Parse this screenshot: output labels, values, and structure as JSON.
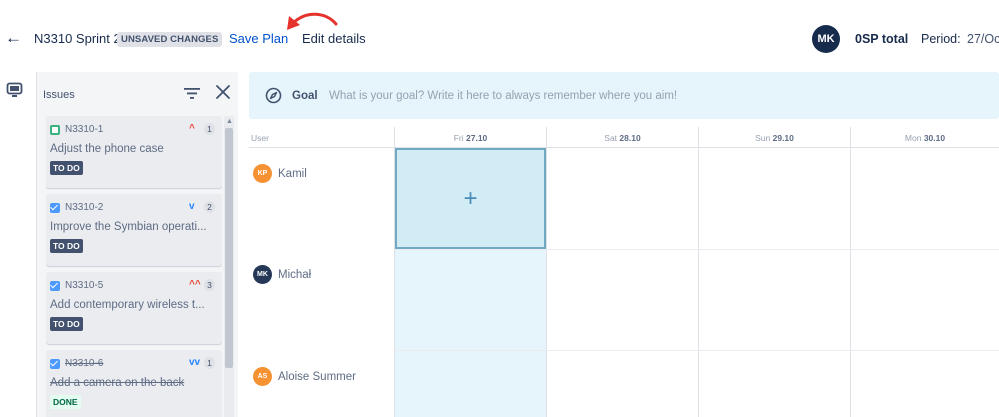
{
  "header": {
    "plan_title": "N3310 Sprint 2",
    "unsaved_badge": "UNSAVED CHANGES",
    "save_label": "Save Plan",
    "edit_label": "Edit details",
    "avatar_initials": "MK",
    "total_sp": "0SP total",
    "period_label": "Period:",
    "period_value": "27/Oc"
  },
  "issues_panel": {
    "title": "Issues",
    "issues": [
      {
        "key": "N3310-1",
        "type": "story",
        "priority": "high",
        "priority_glyph": "^",
        "estimate": "1",
        "summary": "Adjust the phone case",
        "status": "TO DO",
        "done": false
      },
      {
        "key": "N3310-2",
        "type": "task",
        "priority": "low",
        "priority_glyph": "v",
        "estimate": "2",
        "summary": "Improve the Symbian operati...",
        "status": "TO DO",
        "done": false
      },
      {
        "key": "N3310-5",
        "type": "task",
        "priority": "highest",
        "priority_glyph": "^^",
        "estimate": "3",
        "summary": "Add contemporary wireless t...",
        "status": "TO DO",
        "done": false
      },
      {
        "key": "N3310-6",
        "type": "task",
        "priority": "lowest",
        "priority_glyph": "vv",
        "estimate": "1",
        "summary": "Add a camera on the back",
        "status": "DONE",
        "done": true
      }
    ]
  },
  "goal": {
    "label": "Goal",
    "placeholder": "What is your goal? Write it here to always remember where you aim!"
  },
  "calendar": {
    "user_column_label": "User",
    "days": [
      {
        "weekday": "Fri",
        "date": "27.10"
      },
      {
        "weekday": "Sat",
        "date": "28.10"
      },
      {
        "weekday": "Sun",
        "date": "29.10"
      },
      {
        "weekday": "Mon",
        "date": "30.10"
      }
    ],
    "add_symbol": "+",
    "users": [
      {
        "initials": "KP",
        "name": "Kamil",
        "color": "#f79232"
      },
      {
        "initials": "MK",
        "name": "Michał",
        "color": "#253858"
      },
      {
        "initials": "AS",
        "name": "Aloise Summer",
        "color": "#f79232"
      }
    ]
  },
  "colors": {
    "accent": "#0052cc",
    "annotation_arrow": "#e5322d",
    "goal_bar": "#e6f5fc",
    "today_column": "#e6f5fc"
  },
  "icons": {
    "back": "arrow-left-icon",
    "rail": "board-icon",
    "filter": "filter-icon",
    "close": "close-icon",
    "goal": "compass-icon"
  }
}
